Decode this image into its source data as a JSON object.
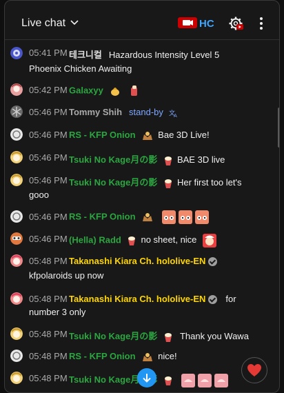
{
  "header": {
    "title": "Live chat",
    "badge_text": "HC",
    "badge_color": "#3ea6ff"
  },
  "icons": {
    "title_dropdown": "chevron-down-icon",
    "badge": "youtube-red-badge-icon",
    "settings": "gear-icon",
    "more": "more-vertical-icon",
    "scroll_down": "arrow-down-icon",
    "reaction": "heart-icon"
  },
  "messages": [
    {
      "time": "05:41 PM",
      "author": "테크니컬",
      "text": "Hazardous Intensity Level 5",
      "cont": "Phoenix Chicken Awaiting"
    },
    {
      "time": "05:42 PM",
      "author": "Galaxyy",
      "text": ""
    },
    {
      "time": "05:46 PM",
      "author": "Tommy Shih",
      "text": "stand-by"
    },
    {
      "time": "05:46 PM",
      "author": "RS - KFP Onion",
      "text": "Bae 3D Live!"
    },
    {
      "time": "05:46 PM",
      "author": "Tsuki No Kage月の影",
      "text": "BAE 3D live"
    },
    {
      "time": "05:46 PM",
      "author": "Tsuki No Kage月の影",
      "text": "Her first too let's",
      "cont": "gooo"
    },
    {
      "time": "05:46 PM",
      "author": "RS - KFP Onion",
      "text": ""
    },
    {
      "time": "05:46 PM",
      "author": "(Hella) Radd",
      "text": "no sheet, nice"
    },
    {
      "time": "05:48 PM",
      "author": "Takanashi Kiara Ch. hololive-EN",
      "text": "",
      "cont": "kfpolaroids up now"
    },
    {
      "time": "05:48 PM",
      "author": "Takanashi Kiara Ch. hololive-EN",
      "text": "for",
      "cont": "number 3 only"
    },
    {
      "time": "05:48 PM",
      "author": "Tsuki No Kage月の影",
      "text": "Thank you Wawa"
    },
    {
      "time": "05:48 PM",
      "author": "RS - KFP Onion",
      "text": "nice!"
    },
    {
      "time": "05:48 PM",
      "author": "Tsuki No Kage月の影",
      "text": ""
    }
  ],
  "colors": {
    "member_name": "#2ba640",
    "owner_name": "#ffd600",
    "timestamp": "#aaaaaa",
    "accent": "#2196f3"
  }
}
